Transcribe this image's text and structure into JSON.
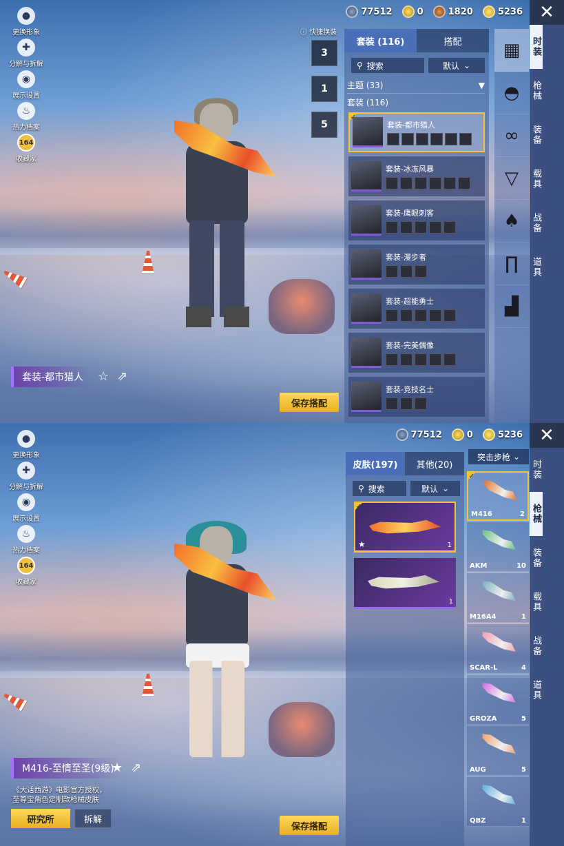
{
  "currency_full": [
    {
      "icon": "silver-coin-icon",
      "value": "77512"
    },
    {
      "icon": "gold-coin-icon",
      "value": "0"
    },
    {
      "icon": "bronze-coin-icon",
      "value": "1820"
    },
    {
      "icon": "uc-coin-icon",
      "value": "5236"
    }
  ],
  "currency_short": [
    {
      "icon": "silver-coin-icon",
      "value": "77512"
    },
    {
      "icon": "gold-coin-icon",
      "value": "0"
    },
    {
      "icon": "uc-coin-icon",
      "value": "5236"
    }
  ],
  "close_label": "✕",
  "left_menu": [
    {
      "label": "更换形象",
      "icon": "avatar-icon"
    },
    {
      "label": "分解与拆解",
      "icon": "puzzle-icon"
    },
    {
      "label": "展示设置",
      "icon": "eye-icon"
    },
    {
      "label": "热力档案",
      "icon": "flame-icon"
    },
    {
      "label": "收藏家",
      "badge": "164",
      "icon": "collector-badge-icon"
    }
  ],
  "categories": [
    "时装",
    "枪械",
    "装备",
    "载具",
    "战备",
    "道具"
  ],
  "screen1": {
    "quick_swap": "快捷换装",
    "hangers": [
      "3",
      "1",
      "5"
    ],
    "tabs": [
      "套装 (116)",
      "搭配"
    ],
    "search": "搜索",
    "sort": "默认",
    "filter": "主题 (33)",
    "subtitle": "套装 (116)",
    "sets": [
      "套装-都市猎人",
      "套装-冰冻风暴",
      "套装-鹰眼刺客",
      "套装-漫步者",
      "套装-超能勇士",
      "套装-完美偶像",
      "套装-竞技名士"
    ],
    "set_parts": [
      6,
      6,
      5,
      3,
      5,
      5,
      3
    ],
    "slots": [
      "vest-icon",
      "helmet-icon",
      "glasses-icon",
      "mask-icon",
      "jacket-icon",
      "pants-icon",
      "boots-icon"
    ],
    "nametag": "套装-都市猎人",
    "save": "保存搭配"
  },
  "screen2": {
    "tabs": [
      "皮肤(197)",
      "其他(20)"
    ],
    "search": "搜索",
    "sort": "默认",
    "weapon_type": "突击步枪",
    "skins": [
      {
        "count": "1"
      },
      {
        "count": "1"
      }
    ],
    "weapons": [
      {
        "name": "M416",
        "count": "2",
        "color": "#e8702a"
      },
      {
        "name": "AKM",
        "count": "10",
        "color": "#6ac080"
      },
      {
        "name": "M16A4",
        "count": "1",
        "color": "#7ab0c0"
      },
      {
        "name": "SCAR-L",
        "count": "4",
        "color": "#f0a0b0"
      },
      {
        "name": "GROZA",
        "count": "5",
        "color": "#d070e0"
      },
      {
        "name": "AUG",
        "count": "5",
        "color": "#f0a070"
      },
      {
        "name": "QBZ",
        "count": "1",
        "color": "#60b0e0"
      }
    ],
    "nametag": "M416-至情至圣(9级)",
    "desc_line1": "《大话西游》电影官方授权，",
    "desc_line2": "至尊宝角色定制款枪械皮肤",
    "research": "研究所",
    "dismantle": "拆解",
    "save": "保存搭配"
  }
}
